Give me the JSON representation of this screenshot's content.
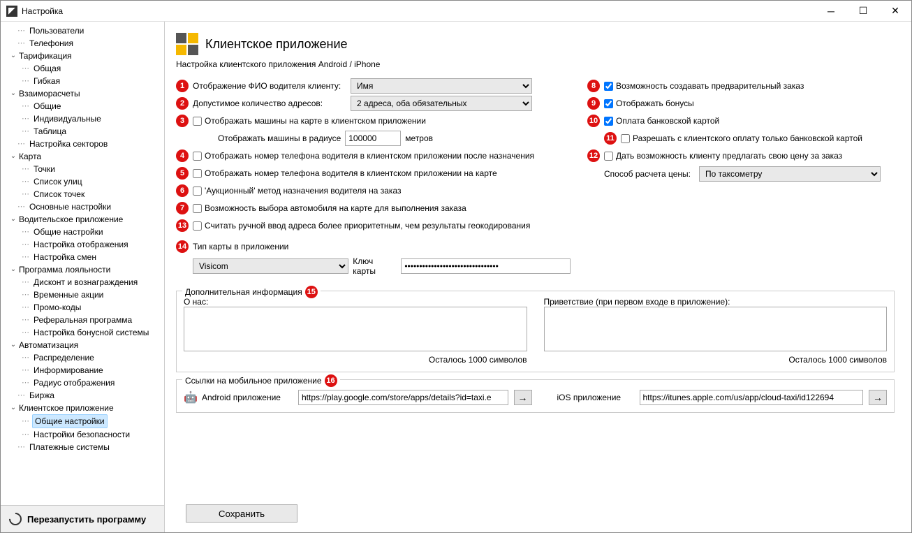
{
  "window": {
    "title": "Настройка"
  },
  "tree": {
    "Пользователи": "Пользователи",
    "Телефония": "Телефония",
    "Тарификация": "Тарификация",
    "Общая": "Общая",
    "Гибкая": "Гибкая",
    "Взаиморасчеты": "Взаиморасчеты",
    "Общие": "Общие",
    "Индивидуальные": "Индивидуальные",
    "Таблица": "Таблица",
    "Настройка_секторов": "Настройка секторов",
    "Карта": "Карта",
    "Точки": "Точки",
    "Список_улиц": "Список улиц",
    "Список_точек": "Список точек",
    "Основные_настройки": "Основные настройки",
    "Водительское_приложение": "Водительское приложение",
    "Общие_настройки": "Общие настройки",
    "Настройка_отображения": "Настройка отображения",
    "Настройка_смен": "Настройка смен",
    "Программа_лояльности": "Программа лояльности",
    "Дисконт_и_вознаграждения": "Дисконт и вознаграждения",
    "Временные_акции": "Временные акции",
    "Промо_коды": "Промо-коды",
    "Реферальная_программа": "Реферальная программа",
    "Настройка_бонусной_системы": "Настройка бонусной системы",
    "Автоматизация": "Автоматизация",
    "Распределение": "Распределение",
    "Информирование": "Информирование",
    "Радиус_отображения": "Радиус отображения",
    "Биржа": "Биржа",
    "Клиентское_приложение": "Клиентское приложение",
    "Настройки_безопасности": "Настройки безопасности",
    "Платежные_системы": "Платежные системы"
  },
  "restart": "Перезапустить программу",
  "header": {
    "title": "Клиентское приложение",
    "sub": "Настройка клиентского приложения Android / iPhone"
  },
  "left": {
    "fio_label": "Отображение ФИО водителя клиенту:",
    "fio_value": "Имя",
    "addr_label": "Допустимое количество адресов:",
    "addr_value": "2 адреса, оба обязательных",
    "cars_on_map": "Отображать машины на карте в клиентском приложении",
    "radius_label": "Отображать машины в радиусе",
    "radius_value": "100000",
    "radius_unit": "метров",
    "phone_after": "Отображать номер телефона водителя в клиентском приложении после назначения",
    "phone_map": "Отображать номер телефона водителя в клиентском приложении на карте",
    "auction": "'Аукционный' метод назначения водителя на заказ",
    "choose_car": "Возможность выбора автомобиля на карте для выполнения заказа",
    "manual_priority": "Считать ручной ввод адреса более приоритетным, чем результаты геокодирования",
    "map_type_label": "Тип карты в приложении",
    "map_type_value": "Visicom",
    "map_key_label": "Ключ карты",
    "map_key_value": "••••••••••••••••••••••••••••••••"
  },
  "right": {
    "preorder": "Возможность создавать предварительный заказ",
    "bonus": "Отображать бонусы",
    "card": "Оплата банковской картой",
    "only_card": "Разрешать с клиентского оплату только банковской картой",
    "offer_price": "Дать возможность клиенту предлагать свою цену за заказ",
    "price_calc_label": "Способ расчета цены:",
    "price_calc_value": "По таксометру"
  },
  "info": {
    "legend": "Дополнительная информация",
    "about_label": "О нас:",
    "about_counter": "Осталось 1000 символов",
    "greet_label": "Приветствие (при первом входе в приложение):",
    "greet_counter": "Осталось 1000 символов"
  },
  "links": {
    "legend": "Ссылки на мобильное приложение",
    "android_label": "Android приложение",
    "android_value": "https://play.google.com/store/apps/details?id=taxi.e",
    "ios_label": "iOS приложение",
    "ios_value": "https://itunes.apple.com/us/app/cloud-taxi/id122694"
  },
  "save": "Сохранить"
}
